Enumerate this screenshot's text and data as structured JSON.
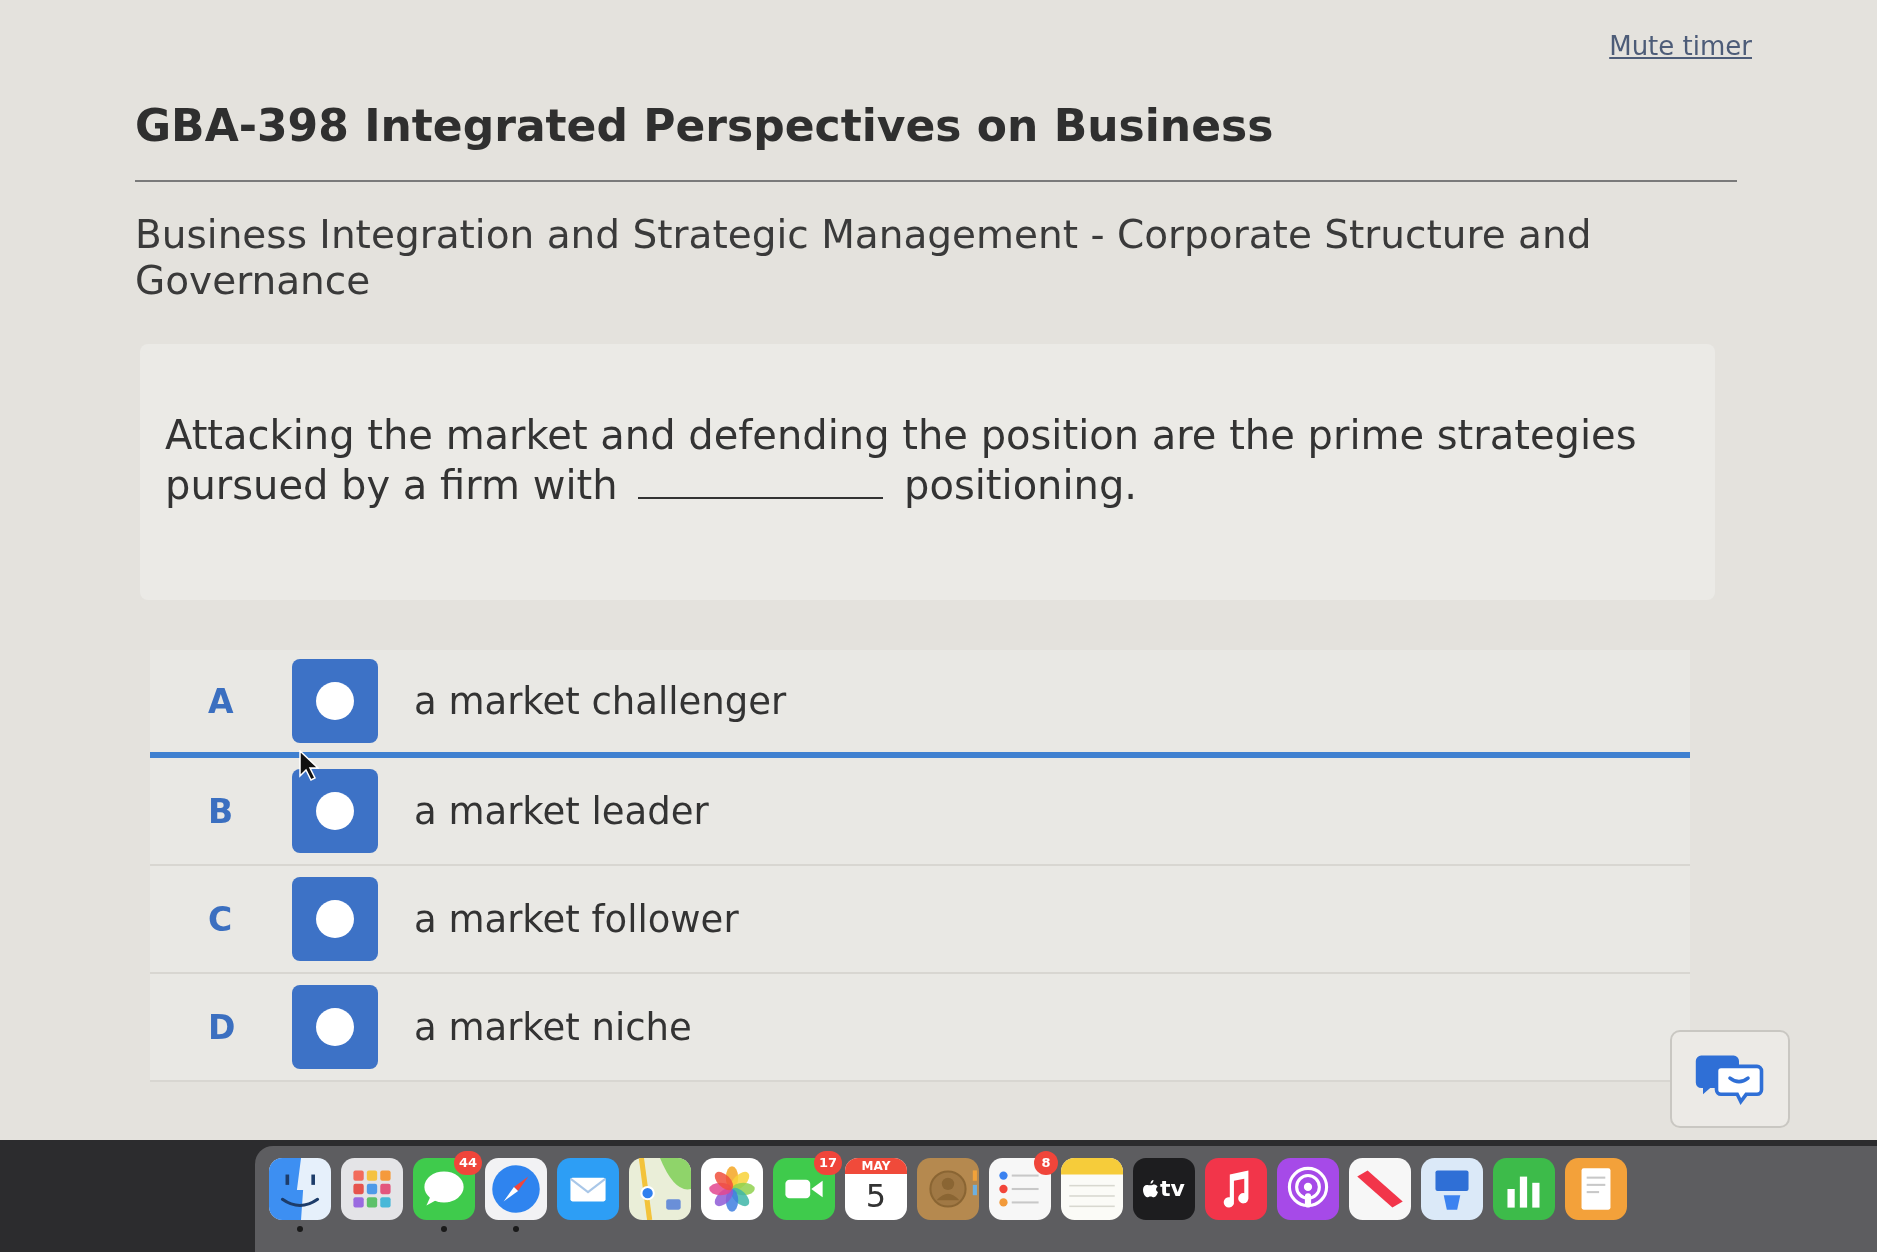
{
  "timer": {
    "mute_link": "Mute timer"
  },
  "course": {
    "title": "GBA-398 Integrated Perspectives on Business",
    "subtitle": "Business Integration and Strategic Management - Corporate Structure and Governance"
  },
  "question": {
    "text_before": "Attacking the market and defending the position are the prime strategies pursued by a firm with",
    "text_after": "positioning."
  },
  "options": [
    {
      "letter": "A",
      "text": "a market challenger",
      "selected": false,
      "hovered": true
    },
    {
      "letter": "B",
      "text": "a market leader",
      "selected": false,
      "hovered": false
    },
    {
      "letter": "C",
      "text": "a market follower",
      "selected": false,
      "hovered": false
    },
    {
      "letter": "D",
      "text": "a market niche",
      "selected": false,
      "hovered": false
    }
  ],
  "dock": {
    "apps": [
      {
        "kind": "finder",
        "running": true
      },
      {
        "kind": "launchpad",
        "running": false
      },
      {
        "kind": "messages",
        "running": true,
        "badge": "44"
      },
      {
        "kind": "safari",
        "running": true
      },
      {
        "kind": "mail",
        "running": false
      },
      {
        "kind": "maps",
        "running": false
      },
      {
        "kind": "photos",
        "running": false
      },
      {
        "kind": "facetime",
        "running": false,
        "badge": "17"
      },
      {
        "kind": "calendar",
        "running": false,
        "month": "MAY",
        "day": "5"
      },
      {
        "kind": "contacts",
        "running": false
      },
      {
        "kind": "reminders",
        "running": false,
        "badge": "8"
      },
      {
        "kind": "notes",
        "running": false
      },
      {
        "kind": "tv",
        "running": false,
        "label": "tv"
      },
      {
        "kind": "music",
        "running": false
      },
      {
        "kind": "podcasts",
        "running": false
      },
      {
        "kind": "news",
        "running": false
      },
      {
        "kind": "keynote",
        "running": false
      },
      {
        "kind": "numbers",
        "running": false
      },
      {
        "kind": "pages",
        "running": false
      }
    ]
  }
}
